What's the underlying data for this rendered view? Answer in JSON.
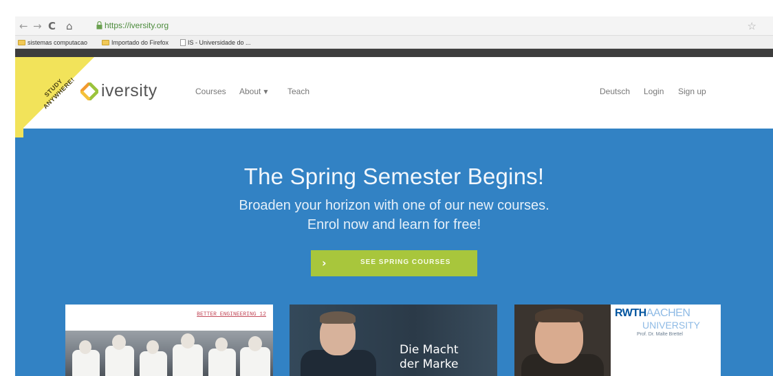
{
  "browser": {
    "url": "https://iversity.org",
    "bookmarks": [
      "sistemas computacao",
      "Importado do Firefox",
      "IS - Universidade do ..."
    ]
  },
  "ribbon": {
    "line1": "STUDY",
    "line2": "ANYWHERE!"
  },
  "brand": {
    "name": "iversity"
  },
  "nav": {
    "courses": "Courses",
    "about": "About",
    "teach": "Teach",
    "language": "Deutsch",
    "login": "Login",
    "signup": "Sign up"
  },
  "hero": {
    "title": "The Spring Semester Begins!",
    "subtitle1": "Broaden your horizon with one of our new courses.",
    "subtitle2": "Enrol now and learn for free!",
    "cta": "SEE SPRING COURSES"
  },
  "cards": [
    {
      "tag": "BETTER ENGINEERING 12"
    },
    {
      "text_line1": "Die Macht",
      "text_line2": "der Marke"
    },
    {
      "logo_bold": "RWTH",
      "logo_light": "AACHEN",
      "logo_line2": "UNIVERSITY",
      "caption": "Prof. Dr. Malte Brettel"
    }
  ],
  "colors": {
    "hero_bg": "#3282c4",
    "cta_bg": "#a8c63c",
    "ribbon": "#f2e35a"
  }
}
